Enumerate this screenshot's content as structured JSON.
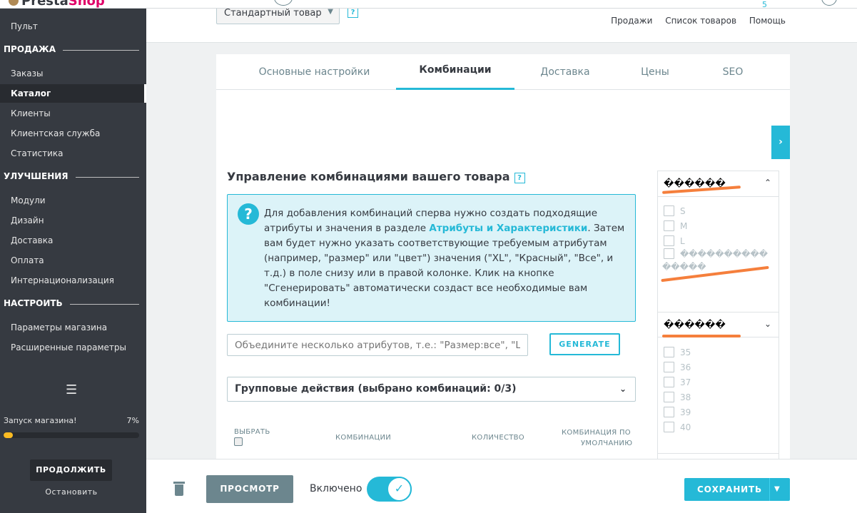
{
  "header": {
    "logo_text": "Presta",
    "logo_text2": "Shop",
    "notifications_count": "5",
    "product_type": "Стандартный товар",
    "help_label": "?",
    "links": [
      "Продажи",
      "Список товаров",
      "Помощь"
    ]
  },
  "sidebar": {
    "items": [
      {
        "label": "Пульт"
      },
      {
        "label": "Заказы"
      },
      {
        "label": "Каталог"
      },
      {
        "label": "Клиенты"
      },
      {
        "label": "Клиентская служба"
      },
      {
        "label": "Статистика"
      },
      {
        "label": "Модули"
      },
      {
        "label": "Дизайн"
      },
      {
        "label": "Доставка"
      },
      {
        "label": "Оплата"
      },
      {
        "label": "Интернационализация"
      },
      {
        "label": "Параметры магазина"
      },
      {
        "label": "Расширенные параметры"
      }
    ],
    "sections": [
      "ПРОДАЖА",
      "УЛУЧШЕНИЯ",
      "НАСТРОИТЬ"
    ],
    "launch_label": "Запуск магазина!",
    "launch_percent": "7%",
    "launch_progress": 0.07,
    "continue_label": "ПРОДОЛЖИТЬ",
    "stop_label": "Остановить"
  },
  "tabs": [
    "Основные настройки",
    "Комбинации",
    "Доставка",
    "Цены",
    "SEO"
  ],
  "combinations": {
    "title": "Управление комбинациями вашего товара",
    "info_line1": "Для добавления комбинаций сперва нужно создать подходящие атрибуты и значения в разделе ",
    "info_link": "Атрибуты и Характеристики",
    "info_line2": ". Затем вам будет нужно указать соответствующие требуемым атрибутам (например, \"размер\" или \"цвет\") значения (\"XL\", \"Красный\", \"Все\", и т.д.) в поле снизу или в правой колонке. Клик на кнопке \"Сгенерировать\" автоматически создаст все необходимые вам комбинации!",
    "input_placeholder": "Объедините несколько атрибутов, т.е.: \"Размер:все\", \"Цвет:красный\"",
    "generate_label": "GENERATE",
    "bulk_label": "Групповые действия (выбрано комбинаций: 0/3)",
    "columns": [
      "ВЫБРАТЬ",
      "КОМБИНАЦИИ",
      "КОЛИЧЕСТВО",
      "КОМБИНАЦИЯ ПО",
      "УМОЛЧАНИЮ"
    ]
  },
  "attributes": {
    "groups": [
      {
        "name": "������",
        "options": [
          "S",
          "M",
          "L",
          "����������",
          "�����"
        ]
      },
      {
        "name": "������",
        "options": [
          "35",
          "36",
          "37",
          "38",
          "39",
          "40"
        ]
      }
    ]
  },
  "footer": {
    "preview_label": "ПРОСМОТР",
    "enabled_label": "Включено",
    "save_label": "СОХРАНИТЬ"
  },
  "colors": {
    "accent": "#25b9d7",
    "sidebar_bg": "#363a41",
    "progress": "#fbbb22",
    "scribble": "#f57f3c"
  }
}
